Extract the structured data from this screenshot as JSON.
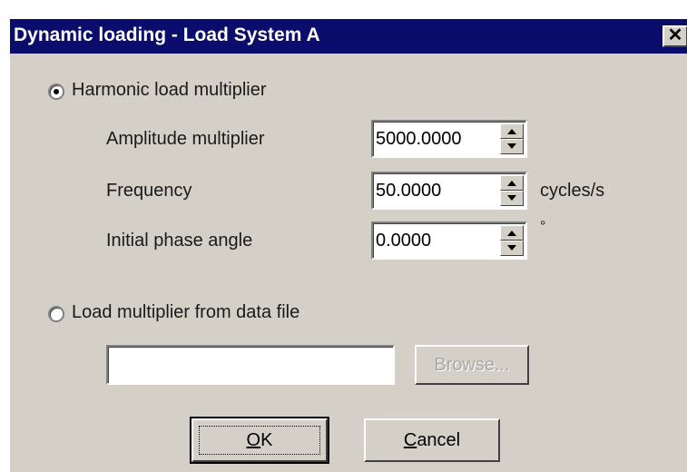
{
  "window": {
    "title": "Dynamic loading - Load System A",
    "close_glyph": "✕"
  },
  "harmonic": {
    "radio_label": "Harmonic load multiplier",
    "selected": true,
    "fields": [
      {
        "label": "Amplitude multiplier",
        "value": "5000.0000",
        "unit": ""
      },
      {
        "label": "Frequency",
        "value": "50.0000",
        "unit": "cycles/s"
      },
      {
        "label": "Initial phase angle",
        "value": "0.0000",
        "unit": "°"
      }
    ]
  },
  "datafile": {
    "radio_label": "Load multiplier from data file",
    "selected": false,
    "path_value": "",
    "browse_label": "Browse..."
  },
  "buttons": {
    "ok_mnemonic": "O",
    "ok_rest": "K",
    "cancel_mnemonic": "C",
    "cancel_rest": "ancel"
  },
  "icons": {
    "spin_up": "triangle-up-icon",
    "spin_down": "triangle-down-icon",
    "close": "close-icon"
  },
  "colors": {
    "titlebar": "#0a0d6b",
    "dialog_bg": "#d4d0c8",
    "disabled_text": "#a8a8a8"
  }
}
